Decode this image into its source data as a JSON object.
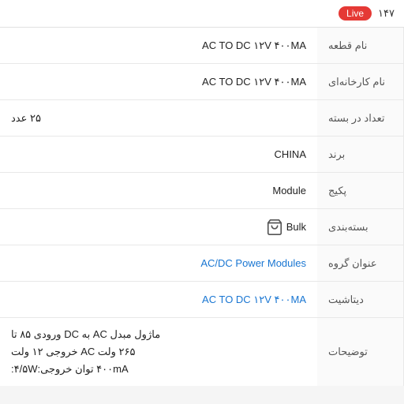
{
  "topbar": {
    "number": "۱۴۷",
    "badge": "Live"
  },
  "rows": [
    {
      "id": "part-name",
      "label": "نام قطعه",
      "value": "AC TO DC ۱۲V ۴۰۰MA",
      "type": "ltr"
    },
    {
      "id": "factory-name",
      "label": "نام کارخانه‌ای",
      "value": "AC TO DC ۱۲V ۴۰۰MA",
      "type": "ltr"
    },
    {
      "id": "count-per-package",
      "label": "تعداد در بسته",
      "value": "۲۵ عدد",
      "type": "normal"
    },
    {
      "id": "brand",
      "label": "برند",
      "value": "CHINA",
      "type": "ltr"
    },
    {
      "id": "package",
      "label": "پکیج",
      "value": "Module",
      "type": "ltr"
    },
    {
      "id": "packaging",
      "label": "بسته‌بندی",
      "value": "Bulk",
      "type": "bag"
    },
    {
      "id": "group-title",
      "label": "عنوان گروه",
      "value": "AC/DC Power Modules",
      "type": "link"
    },
    {
      "id": "datasheet",
      "label": "دیتاشیت",
      "value": "AC TO DC ۱۲V ۴۰۰MA",
      "type": "link-ltr"
    },
    {
      "id": "description",
      "label": "توضیحات",
      "value_lines": [
        "ماژول مبدل AC به DC ورودی ۸۵ تا",
        "۲۶۵ ولت AC خروجی ۱۲ ولت",
        "۴۰۰mA توان خروجی:۴/۵W:"
      ],
      "type": "multiline"
    }
  ]
}
